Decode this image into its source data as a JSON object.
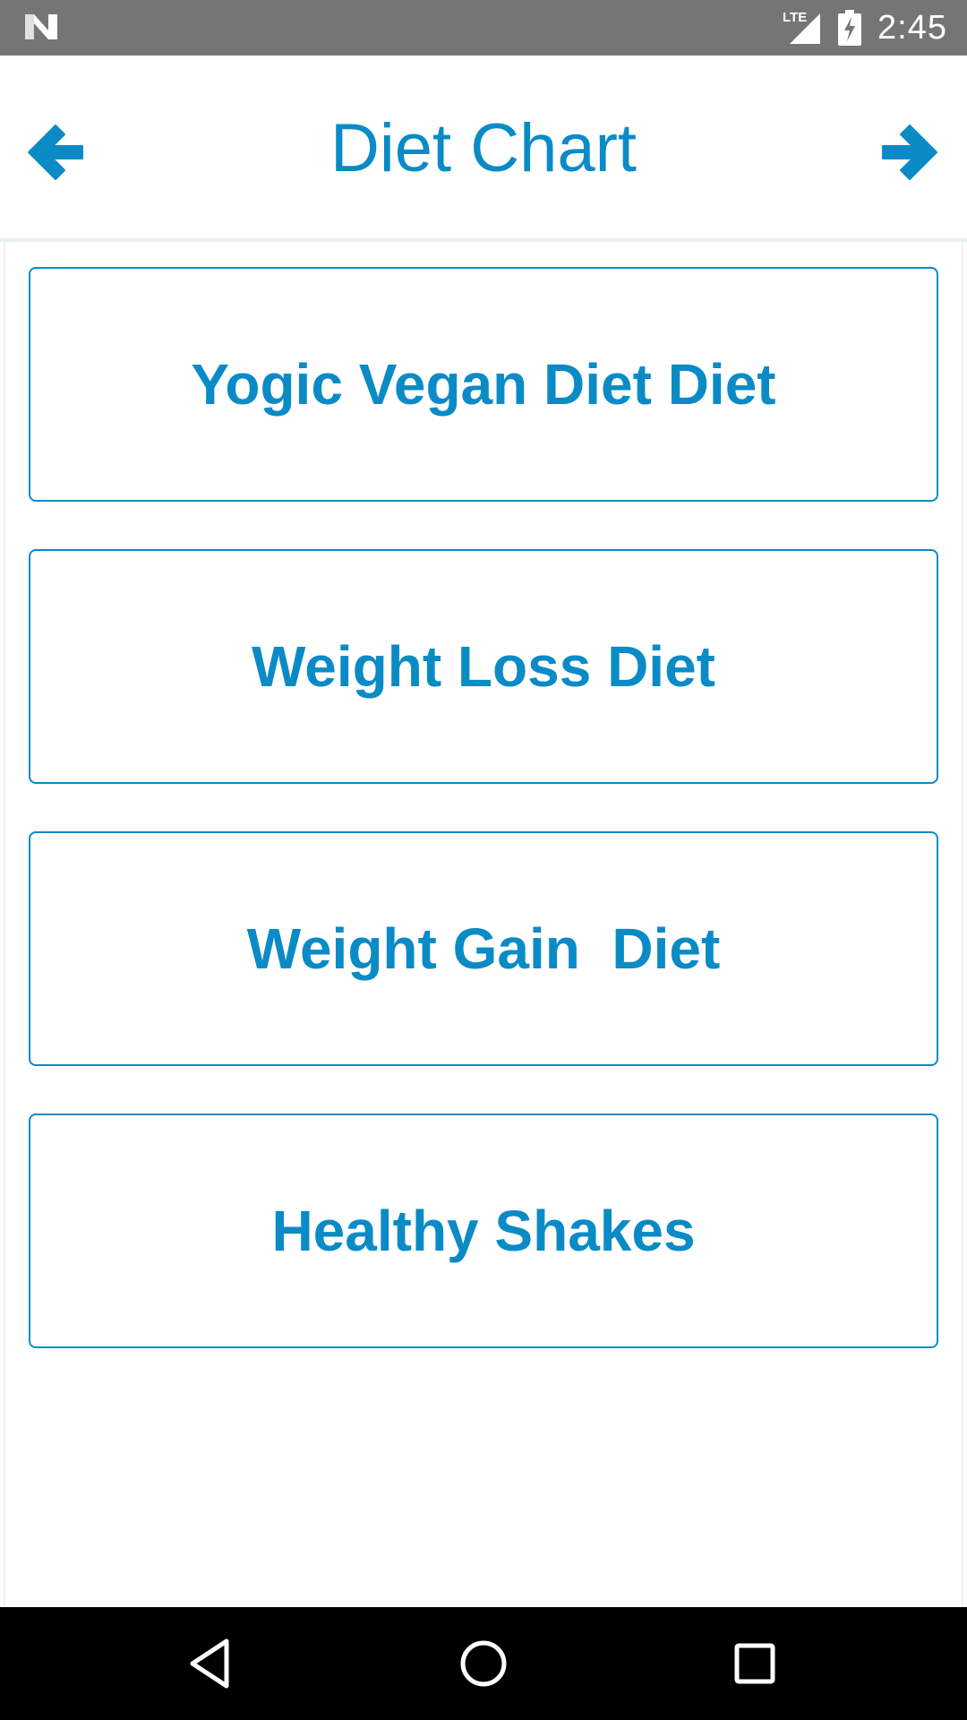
{
  "status_bar": {
    "network_label": "LTE",
    "time": "2:45",
    "icons": [
      "n-logo-icon",
      "signal-icon",
      "battery-charging-icon"
    ]
  },
  "toolbar": {
    "title": "Diet Chart",
    "back_icon": "arrow-left-icon",
    "forward_icon": "arrow-right-icon"
  },
  "menu": {
    "items": [
      {
        "label": "Yogic Vegan Diet Diet"
      },
      {
        "label": "Weight Loss Diet"
      },
      {
        "label": "Weight Gain  Diet"
      },
      {
        "label": "Healthy Shakes"
      }
    ]
  },
  "nav_bar": {
    "icons": [
      "back-triangle-icon",
      "home-circle-icon",
      "recents-square-icon"
    ]
  },
  "colors": {
    "accent": "#0a8bc6",
    "status_bar": "#757575",
    "nav_bar": "#000000"
  }
}
